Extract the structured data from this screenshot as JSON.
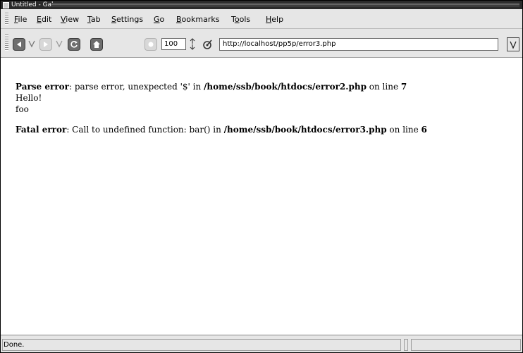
{
  "window": {
    "title": "Untitled - Galeon"
  },
  "menubar": {
    "items": [
      {
        "ul": "F",
        "rest": "ile"
      },
      {
        "ul": "E",
        "rest": "dit"
      },
      {
        "ul": "V",
        "rest": "iew"
      },
      {
        "ul": "T",
        "rest": "ab"
      },
      {
        "ul": "S",
        "rest": "ettings"
      },
      {
        "ul": "G",
        "rest": "o"
      },
      {
        "ul": "B",
        "rest": "ookmarks"
      },
      {
        "pre": "T",
        "ul": "o",
        "rest": "ols"
      },
      {
        "ul": "H",
        "rest": "elp"
      }
    ]
  },
  "toolbar": {
    "zoom_value": "100",
    "url": "http://localhost/pp5p/error3.php",
    "icons": [
      "back-icon",
      "back-history-dropdown-icon",
      "forward-icon",
      "forward-history-dropdown-icon",
      "reload-icon",
      "home-icon",
      "stop-icon",
      "zoom-spinner-icon",
      "location-icon",
      "url-dropdown-icon"
    ]
  },
  "content": {
    "parse_error": {
      "label": "Parse error",
      "message": ": parse error, unexpected '$' in ",
      "file": "/home/ssb/book/htdocs/error2.php",
      "on_line": " on line ",
      "line": "7"
    },
    "hello": "Hello!",
    "foo": "foo",
    "fatal_error": {
      "label": "Fatal error",
      "message": ": Call to undefined function: bar() in ",
      "file": "/home/ssb/book/htdocs/error3.php",
      "on_line": " on line ",
      "line": "6"
    }
  },
  "status": {
    "text": "Done."
  }
}
